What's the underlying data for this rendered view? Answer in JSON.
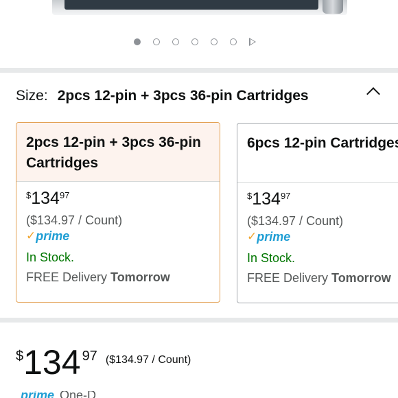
{
  "carousel": {
    "dots": 6,
    "active_index": 0
  },
  "size": {
    "label": "Size:",
    "value": "2pcs 12-pin + 3pcs 36-pin Cartridges"
  },
  "options": [
    {
      "title": "2pcs 12-pin + 3pcs 36-pin Cartridges",
      "price_symbol": "$",
      "price_whole": "134",
      "price_fraction": "97",
      "per_count": "($134.97 / Count)",
      "prime_label": "prime",
      "stock": "In Stock.",
      "delivery_prefix": "FREE Delivery ",
      "delivery_day": "Tomorrow",
      "selected": true
    },
    {
      "title": "6pcs 12-pin Cartridges",
      "price_symbol": "$",
      "price_whole": "134",
      "price_fraction": "97",
      "per_count": "($134.97 / Count)",
      "prime_label": "prime",
      "stock": "In Stock.",
      "delivery_prefix": "FREE Delivery ",
      "delivery_day": "Tomorrow",
      "selected": false
    }
  ],
  "main_price": {
    "symbol": "$",
    "whole": "134",
    "fraction": "97",
    "per_count": "($134.97 / Count)"
  },
  "bottom_prime": {
    "label": "prime",
    "extra": "One-D"
  },
  "colors": {
    "selected_border": "#e3a154",
    "selected_head_bg": "#fdf3ee",
    "stock_green": "#007600",
    "prime_blue": "#1f9ed4",
    "prime_check": "#f0a42d"
  }
}
